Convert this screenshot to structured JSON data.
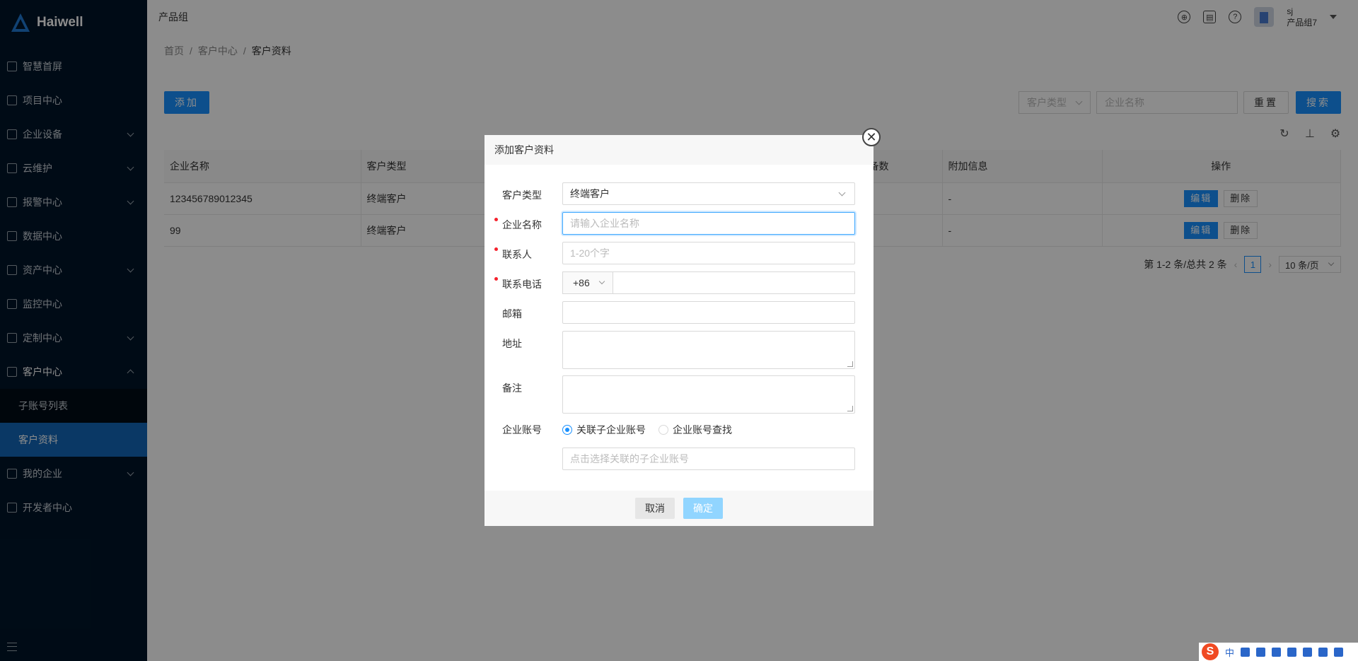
{
  "app": {
    "brand": "Haiwell"
  },
  "sidebar": {
    "items": [
      {
        "label": "智慧首屏",
        "has_children": false
      },
      {
        "label": "项目中心",
        "has_children": false
      },
      {
        "label": "企业设备",
        "has_children": true
      },
      {
        "label": "云维护",
        "has_children": true
      },
      {
        "label": "报警中心",
        "has_children": true
      },
      {
        "label": "数据中心",
        "has_children": false
      },
      {
        "label": "资产中心",
        "has_children": true
      },
      {
        "label": "监控中心",
        "has_children": false
      },
      {
        "label": "定制中心",
        "has_children": true
      },
      {
        "label": "客户中心",
        "has_children": true,
        "expanded": true
      },
      {
        "label": "我的企业",
        "has_children": true
      },
      {
        "label": "开发者中心",
        "has_children": false
      }
    ],
    "subitems": [
      {
        "label": "子账号列表",
        "active": false
      },
      {
        "label": "客户资料",
        "active": true
      }
    ]
  },
  "header": {
    "title": "产品组",
    "user_name": "sj",
    "user_group": "产品组7",
    "icons": [
      "globe-icon",
      "store-icon",
      "help-icon"
    ]
  },
  "breadcrumb": [
    "首页",
    "客户中心",
    "客户资料"
  ],
  "toolbar": {
    "add_label": "添加",
    "customer_type_placeholder": "客户类型",
    "company_name_placeholder": "企业名称",
    "reset_label": "重置",
    "search_label": "搜索",
    "tool_icons": [
      "refresh-icon",
      "density-icon",
      "settings-icon"
    ]
  },
  "table": {
    "headers": [
      "企业名称",
      "客户类型",
      "",
      "备数",
      "附加信息",
      "操作"
    ],
    "rows": [
      {
        "company": "123456789012345",
        "type": "终端客户",
        "info": "-"
      },
      {
        "company": "99",
        "type": "终端客户",
        "info": "-"
      }
    ],
    "edit_label": "编辑",
    "delete_label": "删除"
  },
  "pagination": {
    "summary": "第 1-2 条/总共 2 条",
    "current_page": "1",
    "page_size": "10 条/页"
  },
  "modal": {
    "title": "添加客户资料",
    "fields": {
      "customer_type_label": "客户类型",
      "customer_type_value": "终端客户",
      "company_name_label": "企业名称",
      "company_name_placeholder": "请输入企业名称",
      "contact_label": "联系人",
      "contact_placeholder": "1-20个字",
      "phone_label": "联系电话",
      "phone_prefix": "+86",
      "email_label": "邮箱",
      "address_label": "地址",
      "remark_label": "备注",
      "account_label": "企业账号",
      "radio_link_sub": "关联子企业账号",
      "radio_search": "企业账号查找",
      "account_placeholder": "点击选择关联的子企业账号"
    },
    "cancel_label": "取消",
    "ok_label": "确定",
    "close_glyph": "✕"
  },
  "ime": {
    "mode": "中"
  },
  "colors": {
    "primary": "#1890ff",
    "sidebar": "#001529",
    "active_menu": "#1367b8"
  }
}
